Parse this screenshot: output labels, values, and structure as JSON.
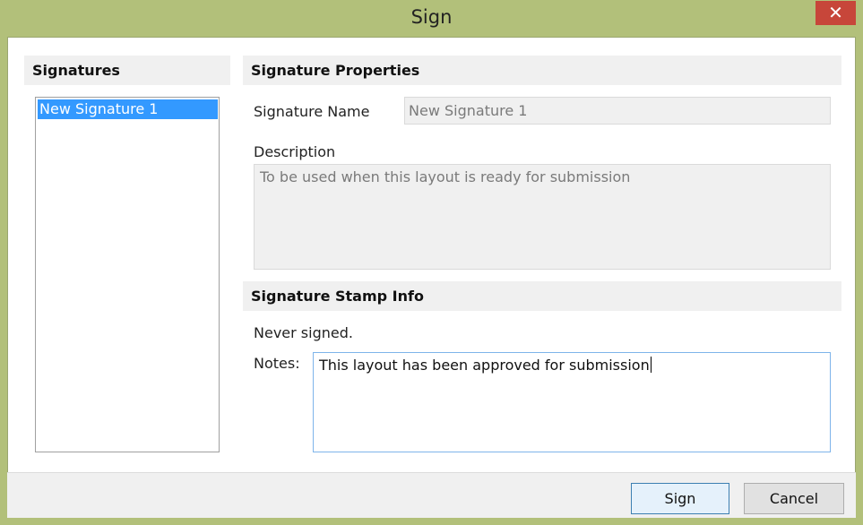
{
  "window": {
    "title": "Sign",
    "close_glyph": "✕"
  },
  "signatures_panel": {
    "header": "Signatures",
    "items": [
      {
        "label": "New Signature 1",
        "selected": true
      }
    ]
  },
  "properties_panel": {
    "header": "Signature Properties",
    "name_label": "Signature Name",
    "name_value": "New Signature 1",
    "description_label": "Description",
    "description_value": "To be used when this layout is ready for submission"
  },
  "stamp_panel": {
    "header": "Signature Stamp Info",
    "status": "Never signed.",
    "notes_label": "Notes:",
    "notes_value": "This layout has been approved for submission"
  },
  "footer": {
    "sign_label": "Sign",
    "cancel_label": "Cancel"
  },
  "colors": {
    "window_frame": "#b2c07a",
    "close_button": "#c7463a",
    "selection": "#3399ff",
    "focus_border": "#7eb4ea"
  }
}
